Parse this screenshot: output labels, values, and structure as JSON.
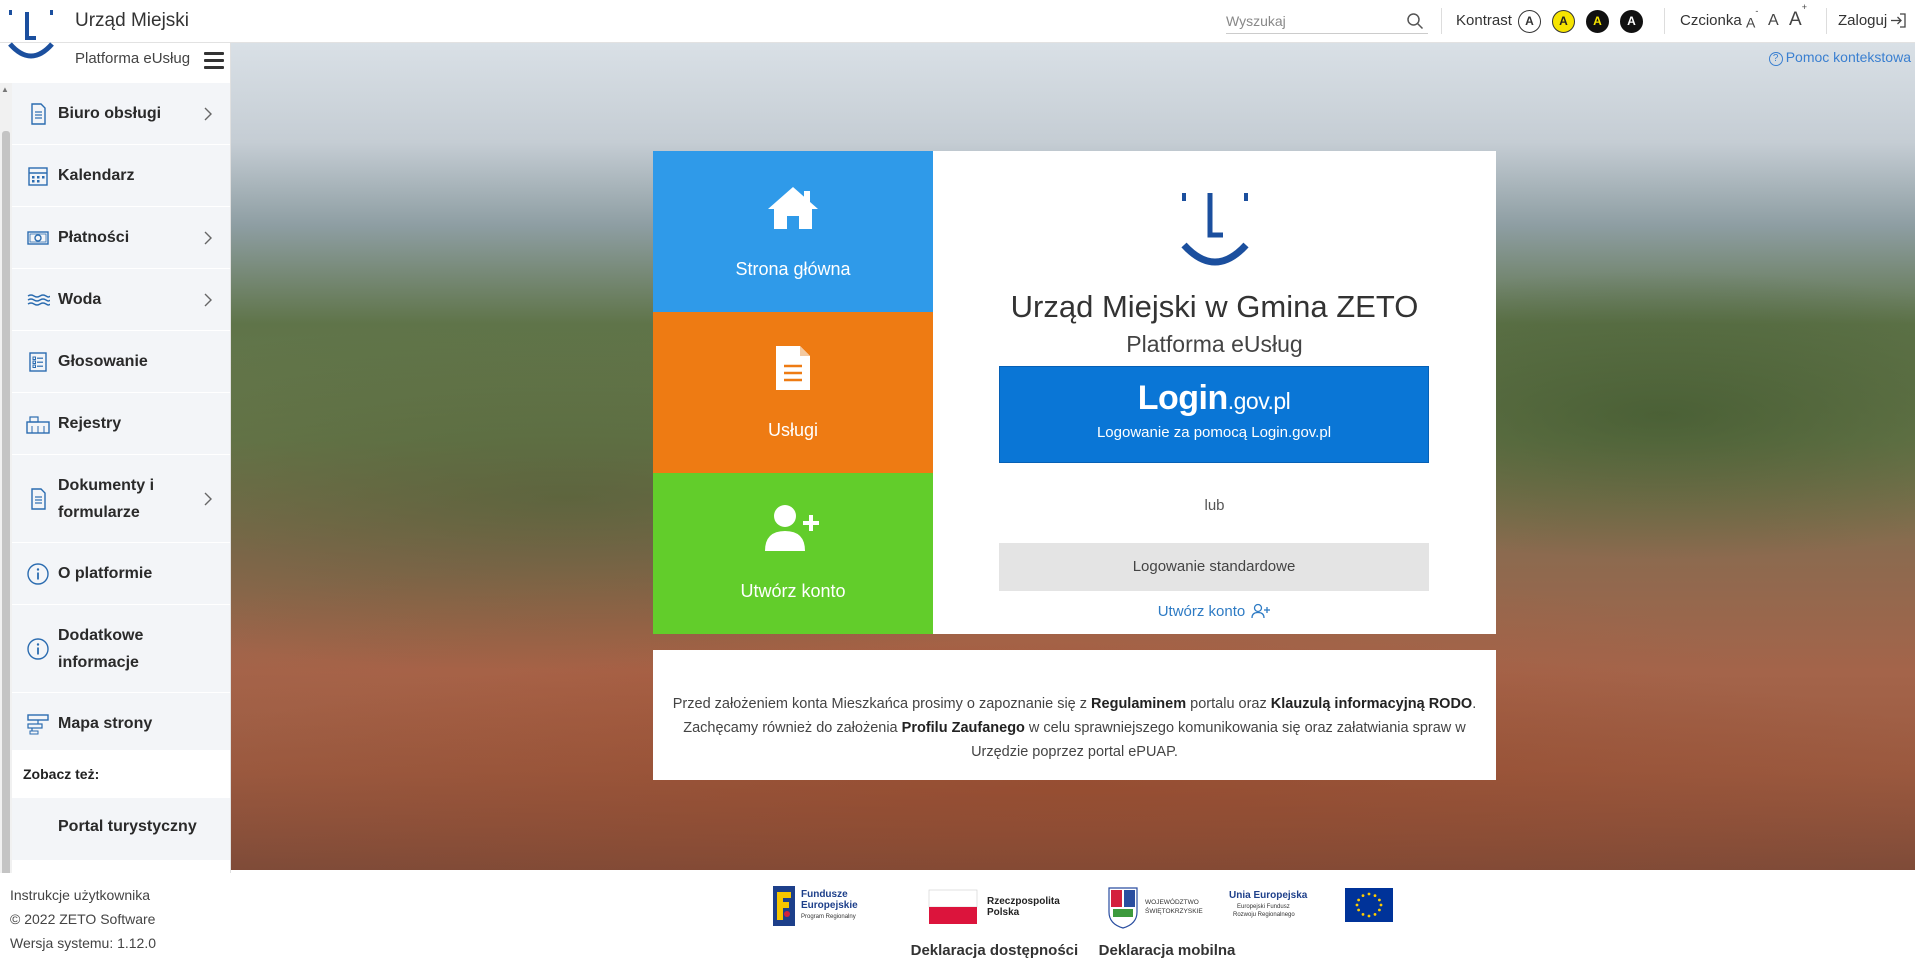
{
  "header": {
    "app_title": "Urząd Miejski",
    "search_placeholder": "Wyszukaj",
    "contrast_label": "Kontrast",
    "contrast_options": [
      "A",
      "A",
      "A",
      "A"
    ],
    "font_label": "Czcionka",
    "font_options": [
      "A",
      "A",
      "A"
    ],
    "font_decrease_mark": "-",
    "font_increase_mark": "+",
    "login_label": "Zaloguj"
  },
  "sidebar": {
    "platform_label": "Platforma eUsług",
    "items": [
      {
        "label": "Biuro obsługi",
        "icon": "document-icon"
      },
      {
        "label": "Kalendarz",
        "icon": "calendar-icon"
      },
      {
        "label": "Płatności",
        "icon": "money-icon"
      },
      {
        "label": "Woda",
        "icon": "water-icon"
      },
      {
        "label": "Głosowanie",
        "icon": "voting-list-icon"
      },
      {
        "label": "Rejestry",
        "icon": "registry-icon"
      },
      {
        "label": "Dokumenty i formularze",
        "icon": "document-icon"
      },
      {
        "label": "O platformie",
        "icon": "info-icon"
      },
      {
        "label": "Dodatkowe informacje",
        "icon": "info-icon"
      },
      {
        "label": "Mapa strony",
        "icon": "sitemap-icon"
      }
    ],
    "see_also_label": "Zobacz też:",
    "portal_link": "Portal turystyczny",
    "footer": {
      "manual": "Instrukcje użytkownika",
      "copyright": "© 2022 ZETO Software",
      "version": "Wersja systemu: 1.12.0"
    }
  },
  "main": {
    "help_link": "Pomoc kontekstowa",
    "tiles": {
      "home": "Strona główna",
      "services": "Usługi",
      "create_account": "Utwórz konto"
    },
    "login_panel": {
      "title": "Urząd Miejski w Gmina ZETO",
      "subtitle": "Platforma eUsług",
      "logingov_brand": "Login",
      "logingov_domain": ".gov.pl",
      "logingov_sub": "Logowanie za pomocą Login.gov.pl",
      "or": "lub",
      "standard_login": "Logowanie standardowe",
      "create_account_link": "Utwórz konto"
    },
    "info": {
      "p1": "Przed założeniem konta Mieszkańca prosimy o zapoznanie się z ",
      "regulamin": "Regulaminem",
      "p2": " portalu oraz ",
      "rodo": "Klauzulą informacyjną RODO",
      "p3": ". Zachęcamy również do założenia ",
      "profil": "Profilu Zaufanego",
      "p4": " w celu sprawniejszego komunikowania się oraz załatwiania spraw w Urzędzie poprzez portal ePUAP."
    }
  },
  "footer": {
    "logos": {
      "fe_line1": "Fundusze",
      "fe_line2": "Europejskie",
      "fe_line3": "Program Regionalny",
      "rp_line1": "Rzeczpospolita",
      "rp_line2": "Polska",
      "ws_line1": "WOJEWÓDZTWO",
      "ws_line2": "ŚWIĘTOKRZYSKIE",
      "ue_line1": "Unia Europejska",
      "ue_line2": "Europejski Fundusz",
      "ue_line3": "Rozwoju Regionalnego"
    },
    "accessibility_declaration": "Deklaracja dostępności",
    "mobile_declaration": "Deklaracja mobilna"
  },
  "colors": {
    "tile_home": "#2f9ae9",
    "tile_services": "#ee7b13",
    "tile_create": "#62cd2b",
    "logingov_blue": "#0a76d6",
    "logo_blue": "#1b4f9e",
    "link_blue": "#2e7bc4"
  }
}
